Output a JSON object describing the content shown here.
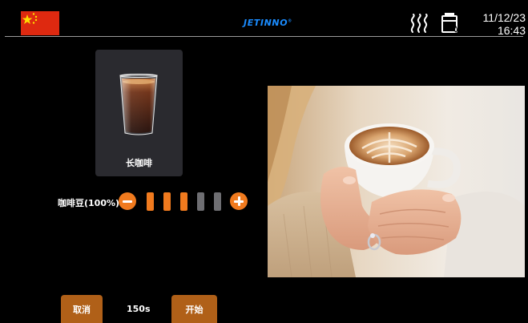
{
  "header": {
    "brand": "JETINNO",
    "brand_mark": "®",
    "date": "11/12/23",
    "time": "16:43",
    "flag_icon": "china-flag-icon",
    "heating_icon": "heating-waves-icon",
    "boiler_icon": "boiler-status-icon"
  },
  "drink": {
    "name": "长咖啡",
    "image_icon": "long-coffee-cup-icon"
  },
  "strength": {
    "label": "咖啡豆(100%)",
    "level": 3,
    "max_level": 5
  },
  "actions": {
    "cancel_label": "取消",
    "timer": "150s",
    "start_label": "开始"
  },
  "colors": {
    "accent": "#f07a1e",
    "button": "#b06018",
    "brand": "#1a8cff",
    "card": "#2a2a2f",
    "level_off": "#6e6e72"
  }
}
